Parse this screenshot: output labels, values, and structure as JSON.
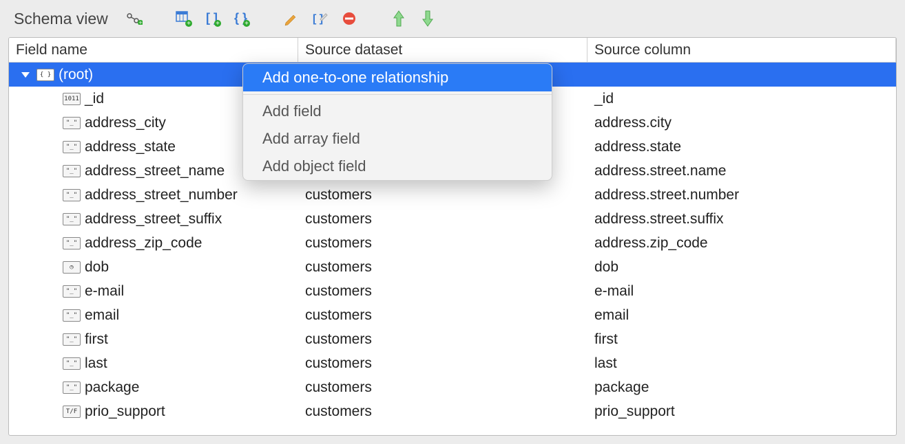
{
  "toolbar": {
    "title": "Schema view"
  },
  "columns": {
    "field_name": "Field name",
    "source_dataset": "Source dataset",
    "source_column": "Source column"
  },
  "root": {
    "label": "(root)"
  },
  "rows": [
    {
      "icon": "1011",
      "field": "_id",
      "ds": "",
      "col": "_id"
    },
    {
      "icon": "str",
      "field": "address_city",
      "ds": "",
      "col": "address.city"
    },
    {
      "icon": "str",
      "field": "address_state",
      "ds": "",
      "col": "address.state"
    },
    {
      "icon": "str",
      "field": "address_street_name",
      "ds": "",
      "col": "address.street.name"
    },
    {
      "icon": "str",
      "field": "address_street_number",
      "ds": "customers",
      "col": "address.street.number"
    },
    {
      "icon": "str",
      "field": "address_street_suffix",
      "ds": "customers",
      "col": "address.street.suffix"
    },
    {
      "icon": "str",
      "field": "address_zip_code",
      "ds": "customers",
      "col": "address.zip_code"
    },
    {
      "icon": "date",
      "field": "dob",
      "ds": "customers",
      "col": "dob"
    },
    {
      "icon": "str",
      "field": "e-mail",
      "ds": "customers",
      "col": "e-mail"
    },
    {
      "icon": "str",
      "field": "email",
      "ds": "customers",
      "col": "email"
    },
    {
      "icon": "str",
      "field": "first",
      "ds": "customers",
      "col": "first"
    },
    {
      "icon": "str",
      "field": "last",
      "ds": "customers",
      "col": "last"
    },
    {
      "icon": "str",
      "field": "package",
      "ds": "customers",
      "col": "package"
    },
    {
      "icon": "tf",
      "field": "prio_support",
      "ds": "customers",
      "col": "prio_support"
    }
  ],
  "context_menu": {
    "items": [
      {
        "label": "Add one-to-one relationship",
        "highlighted": true
      },
      {
        "sep": true
      },
      {
        "label": "Add field"
      },
      {
        "label": "Add array field"
      },
      {
        "label": "Add object field"
      }
    ]
  }
}
